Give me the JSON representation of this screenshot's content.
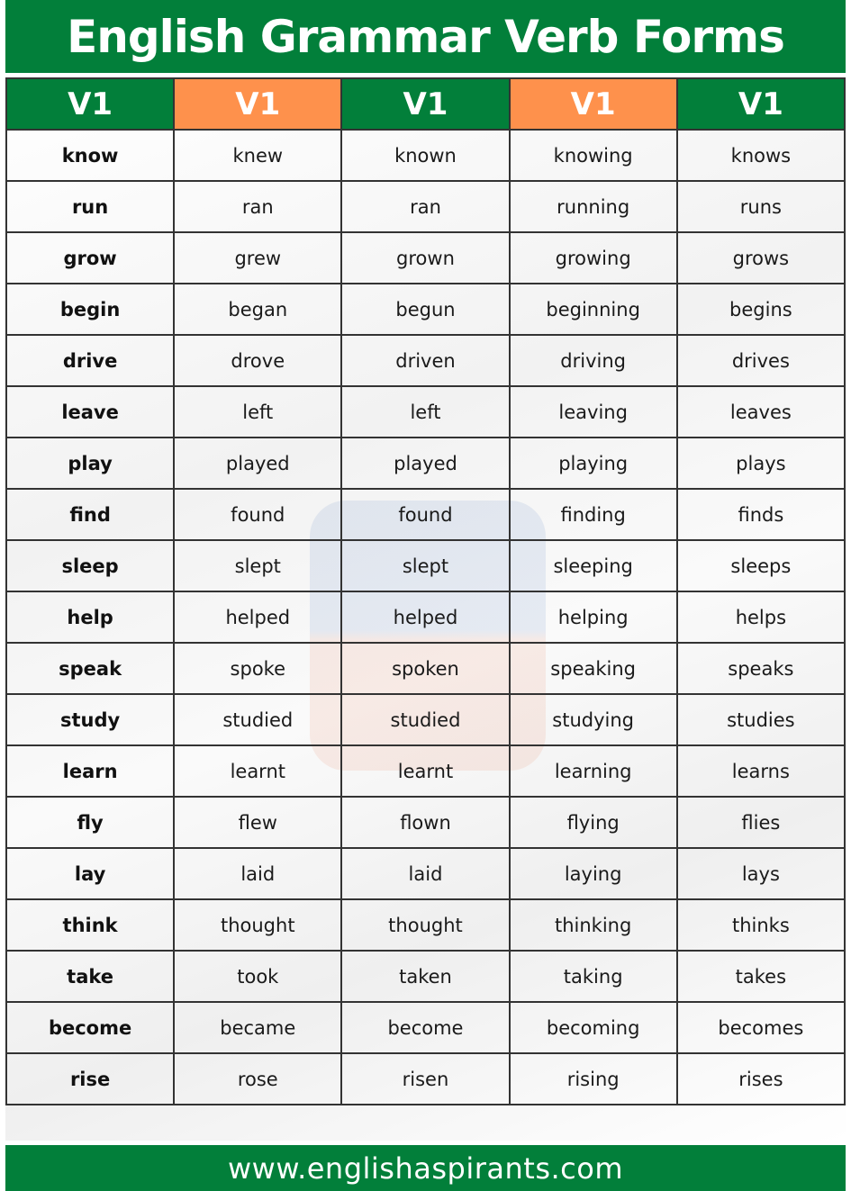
{
  "title": "English Grammar Verb Forms",
  "colors": {
    "green": "#027f3a",
    "orange": "#fe914c"
  },
  "table": {
    "headers": [
      "V1",
      "V1",
      "V1",
      "V1",
      "V1"
    ],
    "rows": [
      [
        "know",
        "knew",
        "known",
        "knowing",
        "knows"
      ],
      [
        "run",
        "ran",
        "ran",
        "running",
        "runs"
      ],
      [
        "grow",
        "grew",
        "grown",
        "growing",
        "grows"
      ],
      [
        "begin",
        "began",
        "begun",
        "beginning",
        "begins"
      ],
      [
        "drive",
        "drove",
        "driven",
        "driving",
        "drives"
      ],
      [
        "leave",
        "left",
        "left",
        "leaving",
        "leaves"
      ],
      [
        "play",
        "played",
        "played",
        "playing",
        "plays"
      ],
      [
        "find",
        "found",
        "found",
        "finding",
        "finds"
      ],
      [
        "sleep",
        "slept",
        "slept",
        "sleeping",
        "sleeps"
      ],
      [
        "help",
        "helped",
        "helped",
        "helping",
        "helps"
      ],
      [
        "speak",
        "spoke",
        "spoken",
        "speaking",
        "speaks"
      ],
      [
        "study",
        "studied",
        "studied",
        "studying",
        "studies"
      ],
      [
        "learn",
        "learnt",
        "learnt",
        "learning",
        "learns"
      ],
      [
        "fly",
        "flew",
        "flown",
        "flying",
        "flies"
      ],
      [
        "lay",
        "laid",
        "laid",
        "laying",
        "lays"
      ],
      [
        "think",
        "thought",
        "thought",
        "thinking",
        "thinks"
      ],
      [
        "take",
        "took",
        "taken",
        "taking",
        "takes"
      ],
      [
        "become",
        "became",
        "become",
        "becoming",
        "becomes"
      ],
      [
        "rise",
        "rose",
        "risen",
        "rising",
        "rises"
      ]
    ]
  },
  "footer": {
    "url": "www.englishaspirants.com"
  }
}
